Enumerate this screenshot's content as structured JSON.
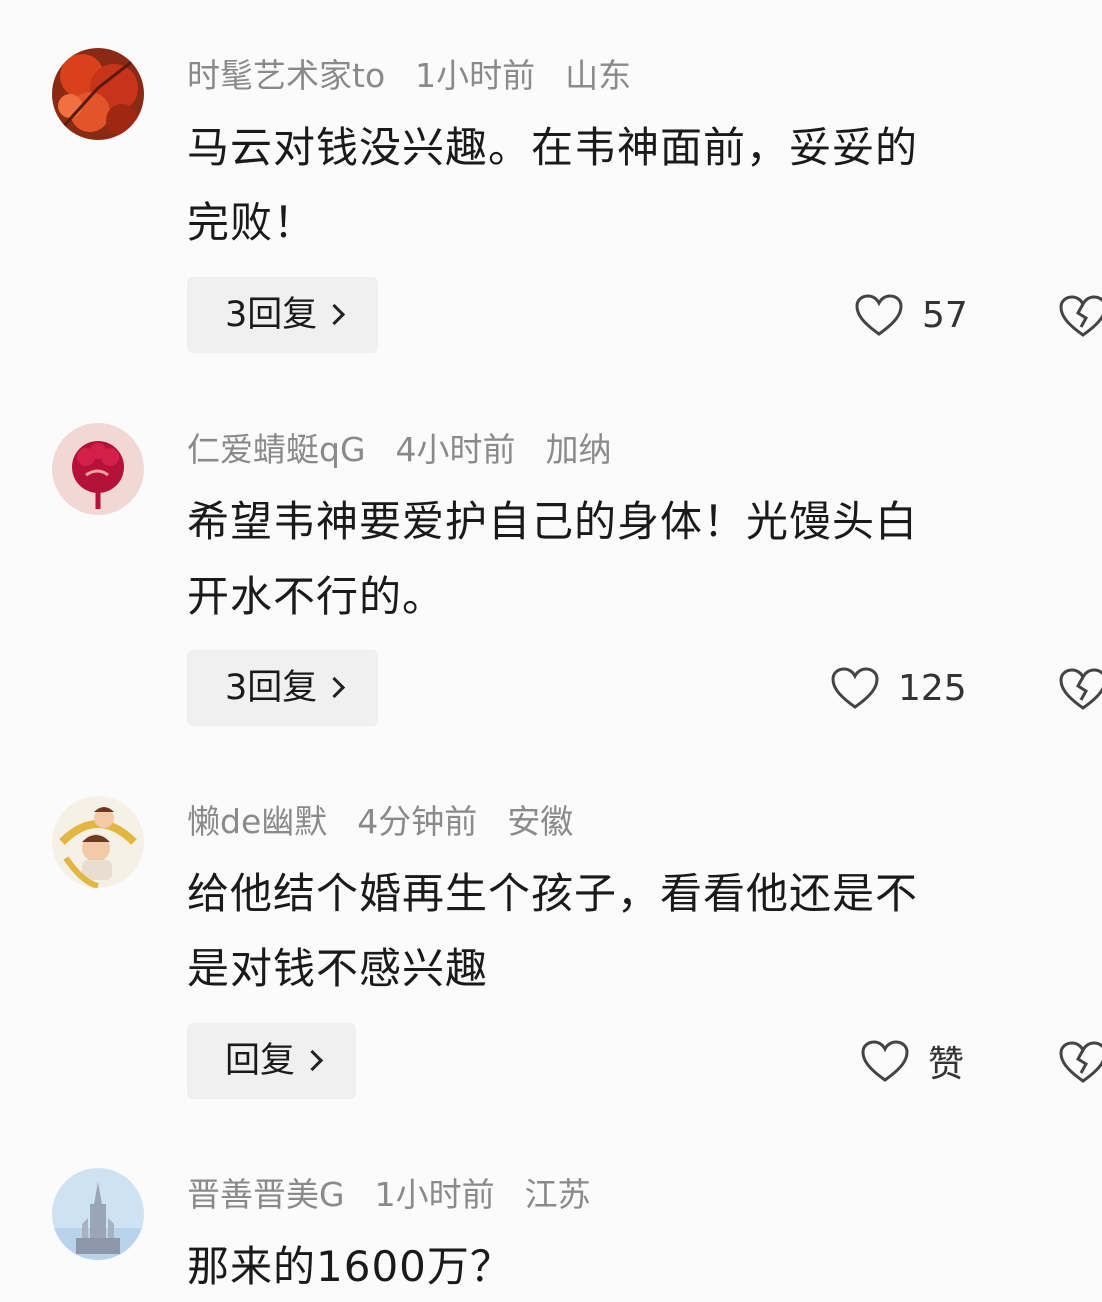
{
  "comments": [
    {
      "username": "时髦艺术家to",
      "time": "1小时前",
      "location": "山东",
      "text_line1": "马云对钱没兴趣。在韦神面前，妥妥的",
      "text_line2": "完败！",
      "reply_label": "3回复",
      "like_count": "57",
      "avatar_icon": "red-maple-leaves-avatar"
    },
    {
      "username": "仁爱蜻蜓qG",
      "time": "4小时前",
      "location": "加纳",
      "text_line1": "希望韦神要爱护自己的身体！光馒头白",
      "text_line2": "开水不行的。",
      "reply_label": "3回复",
      "like_count": "125",
      "avatar_icon": "red-flower-avatar"
    },
    {
      "username": "懒de幽默",
      "time": "4分钟前",
      "location": "安徽",
      "text_line1": "给他结个婚再生个孩子，看看他还是不",
      "text_line2": "是对钱不感兴趣",
      "reply_label": "回复",
      "like_count": "赞",
      "avatar_icon": "cartoon-family-avatar"
    },
    {
      "username": "晋善晋美G",
      "time": "1小时前",
      "location": "江苏",
      "text_line1": "那来的1600万？",
      "avatar_icon": "castle-avatar"
    }
  ],
  "colors": {
    "meta_gray": "#8a8a8a",
    "text_dark": "#1a1a1a",
    "reply_bg": "#f0f0f0"
  }
}
